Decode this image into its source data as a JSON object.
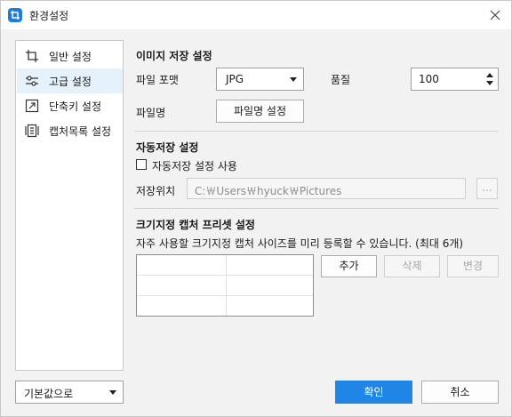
{
  "window": {
    "title": "환경설정"
  },
  "sidebar": {
    "items": [
      {
        "label": "일반 설정",
        "icon": "crop-icon",
        "active": false
      },
      {
        "label": "고급 설정",
        "icon": "sliders-icon",
        "active": true
      },
      {
        "label": "단축키 설정",
        "icon": "shortcut-icon",
        "active": false
      },
      {
        "label": "캡처목록 설정",
        "icon": "capture-list-icon",
        "active": false
      }
    ]
  },
  "image_save": {
    "title": "이미지 저장 설정",
    "format_label": "파일 포맷",
    "format_value": "JPG",
    "quality_label": "품질",
    "quality_value": "100",
    "filename_label": "파일명",
    "filename_button": "파일명 설정"
  },
  "auto_save": {
    "title": "자동저장 설정",
    "checkbox_label": "자동저장 설정 사용",
    "checked": false,
    "location_label": "저장위치",
    "location_value": "C:￦Users￦hyuck￦Pictures",
    "browse_button": "..."
  },
  "preset": {
    "title": "크기지정 캡처 프리셋 설정",
    "description": "자주 사용할 크기지정 캡처 사이즈를 미리 등록할 수 있습니다. (최대 6개)",
    "add_button": "추가",
    "delete_button": "삭제",
    "edit_button": "변경",
    "rows": 3,
    "cols": 2
  },
  "footer": {
    "defaults_value": "기본값으로",
    "ok_button": "확인",
    "cancel_button": "취소"
  },
  "colors": {
    "accent": "#1f86e6",
    "active_item": "#e5f1fb",
    "app_icon": "#1e7be0"
  }
}
